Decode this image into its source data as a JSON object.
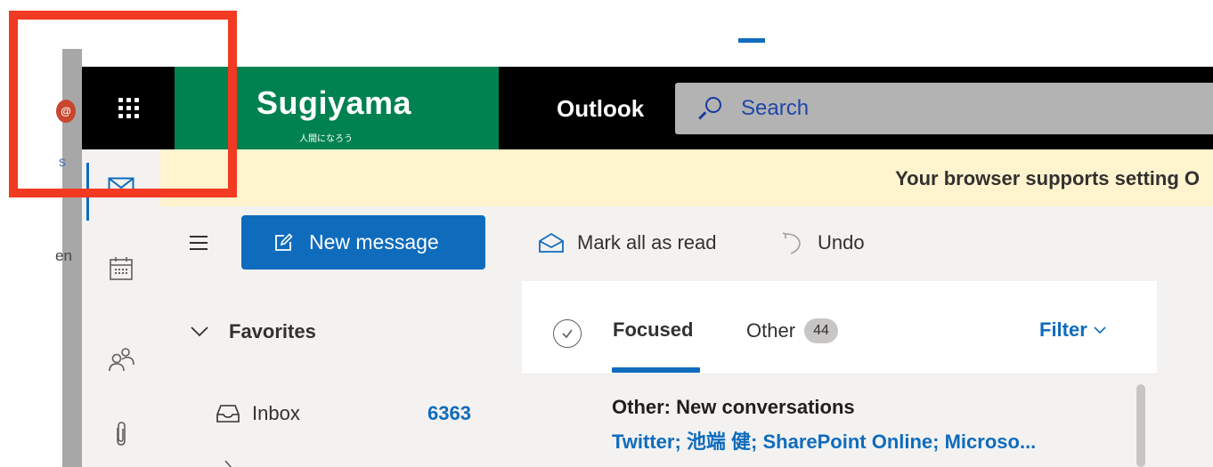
{
  "header": {
    "brand_name": "Sugiyama",
    "brand_tagline": "人間になろう",
    "app_name": "Outlook",
    "search_placeholder": "Search"
  },
  "sidebar_left_fragments": {
    "avatar_glyph": "@",
    "text_s": "s",
    "text_en": "en"
  },
  "banner": {
    "text": "Your browser supports setting O"
  },
  "command_bar": {
    "new_message_label": "New message",
    "mark_all_read_label": "Mark all as read",
    "undo_label": "Undo"
  },
  "folders": {
    "favorites_label": "Favorites",
    "inbox_label": "Inbox",
    "inbox_count": "6363"
  },
  "message_list": {
    "tab_focused": "Focused",
    "tab_other": "Other",
    "other_count": "44",
    "filter_label": "Filter",
    "group_title": "Other: New conversations",
    "group_senders": "Twitter; 池端 健; SharePoint Online; Microso..."
  },
  "colors": {
    "accent": "#0f6cbd",
    "brand_green": "#008250",
    "highlight_red": "#f23a22",
    "banner_yellow": "#fff4ce"
  },
  "icons": [
    "app-launcher-icon",
    "mail-icon",
    "calendar-icon",
    "people-icon",
    "attachment-icon",
    "compose-icon",
    "envelope-open-icon",
    "undo-icon",
    "chevron-down-icon",
    "inbox-icon",
    "check-circle-icon",
    "search-icon"
  ]
}
